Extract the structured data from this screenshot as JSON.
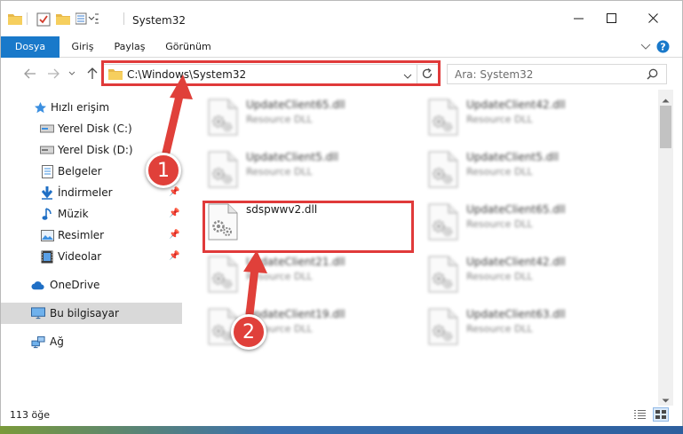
{
  "window": {
    "title": "System32"
  },
  "ribbon": {
    "tabs": [
      {
        "label": "Dosya",
        "active": true
      },
      {
        "label": "Giriş",
        "active": false
      },
      {
        "label": "Paylaş",
        "active": false
      },
      {
        "label": "Görünüm",
        "active": false
      }
    ]
  },
  "address": {
    "path": "C:\\Windows\\System32"
  },
  "search": {
    "placeholder": "Ara: System32"
  },
  "sidebar": {
    "items": [
      {
        "label": "Hızlı erişim",
        "icon": "star-icon"
      },
      {
        "label": "Yerel Disk (C:)",
        "icon": "drive-icon"
      },
      {
        "label": "Yerel Disk (D:)",
        "icon": "drive-icon"
      },
      {
        "label": "Belgeler",
        "icon": "document-icon"
      },
      {
        "label": "İndirmeler",
        "icon": "download-icon"
      },
      {
        "label": "Müzik",
        "icon": "music-icon"
      },
      {
        "label": "Resimler",
        "icon": "pictures-icon"
      },
      {
        "label": "Videolar",
        "icon": "video-icon"
      },
      {
        "label": "OneDrive",
        "icon": "cloud-icon"
      },
      {
        "label": "Bu bilgisayar",
        "icon": "computer-icon"
      },
      {
        "label": "Ağ",
        "icon": "network-icon"
      }
    ]
  },
  "files": [
    {
      "name": "UpdateClient65.dll",
      "type": "Resource DLL",
      "blurred": true
    },
    {
      "name": "UpdateClient42.dll",
      "type": "Resource DLL",
      "blurred": true
    },
    {
      "name": "UpdateClient5.dll",
      "type": "Resource DLL",
      "blurred": true
    },
    {
      "name": "UpdateClient5.dll",
      "type": "Resource DLL",
      "blurred": true
    },
    {
      "name": "sdspwwv2.dll",
      "type": "",
      "blurred": false
    },
    {
      "name": "UpdateClient65.dll",
      "type": "Resource DLL",
      "blurred": true
    },
    {
      "name": "UpdateClient21.dll",
      "type": "Resource DLL",
      "blurred": true
    },
    {
      "name": "UpdateClient42.dll",
      "type": "Resource DLL",
      "blurred": true
    },
    {
      "name": "UpdateClient19.dll",
      "type": "Resource DLL",
      "blurred": true
    },
    {
      "name": "UpdateClient63.dll",
      "type": "Resource DLL",
      "blurred": true
    }
  ],
  "status": {
    "item_count": "113 öğe"
  },
  "annotations": {
    "badge1": "1",
    "badge2": "2",
    "color": "#e03a3a"
  },
  "colors": {
    "accent": "#1979ca"
  }
}
